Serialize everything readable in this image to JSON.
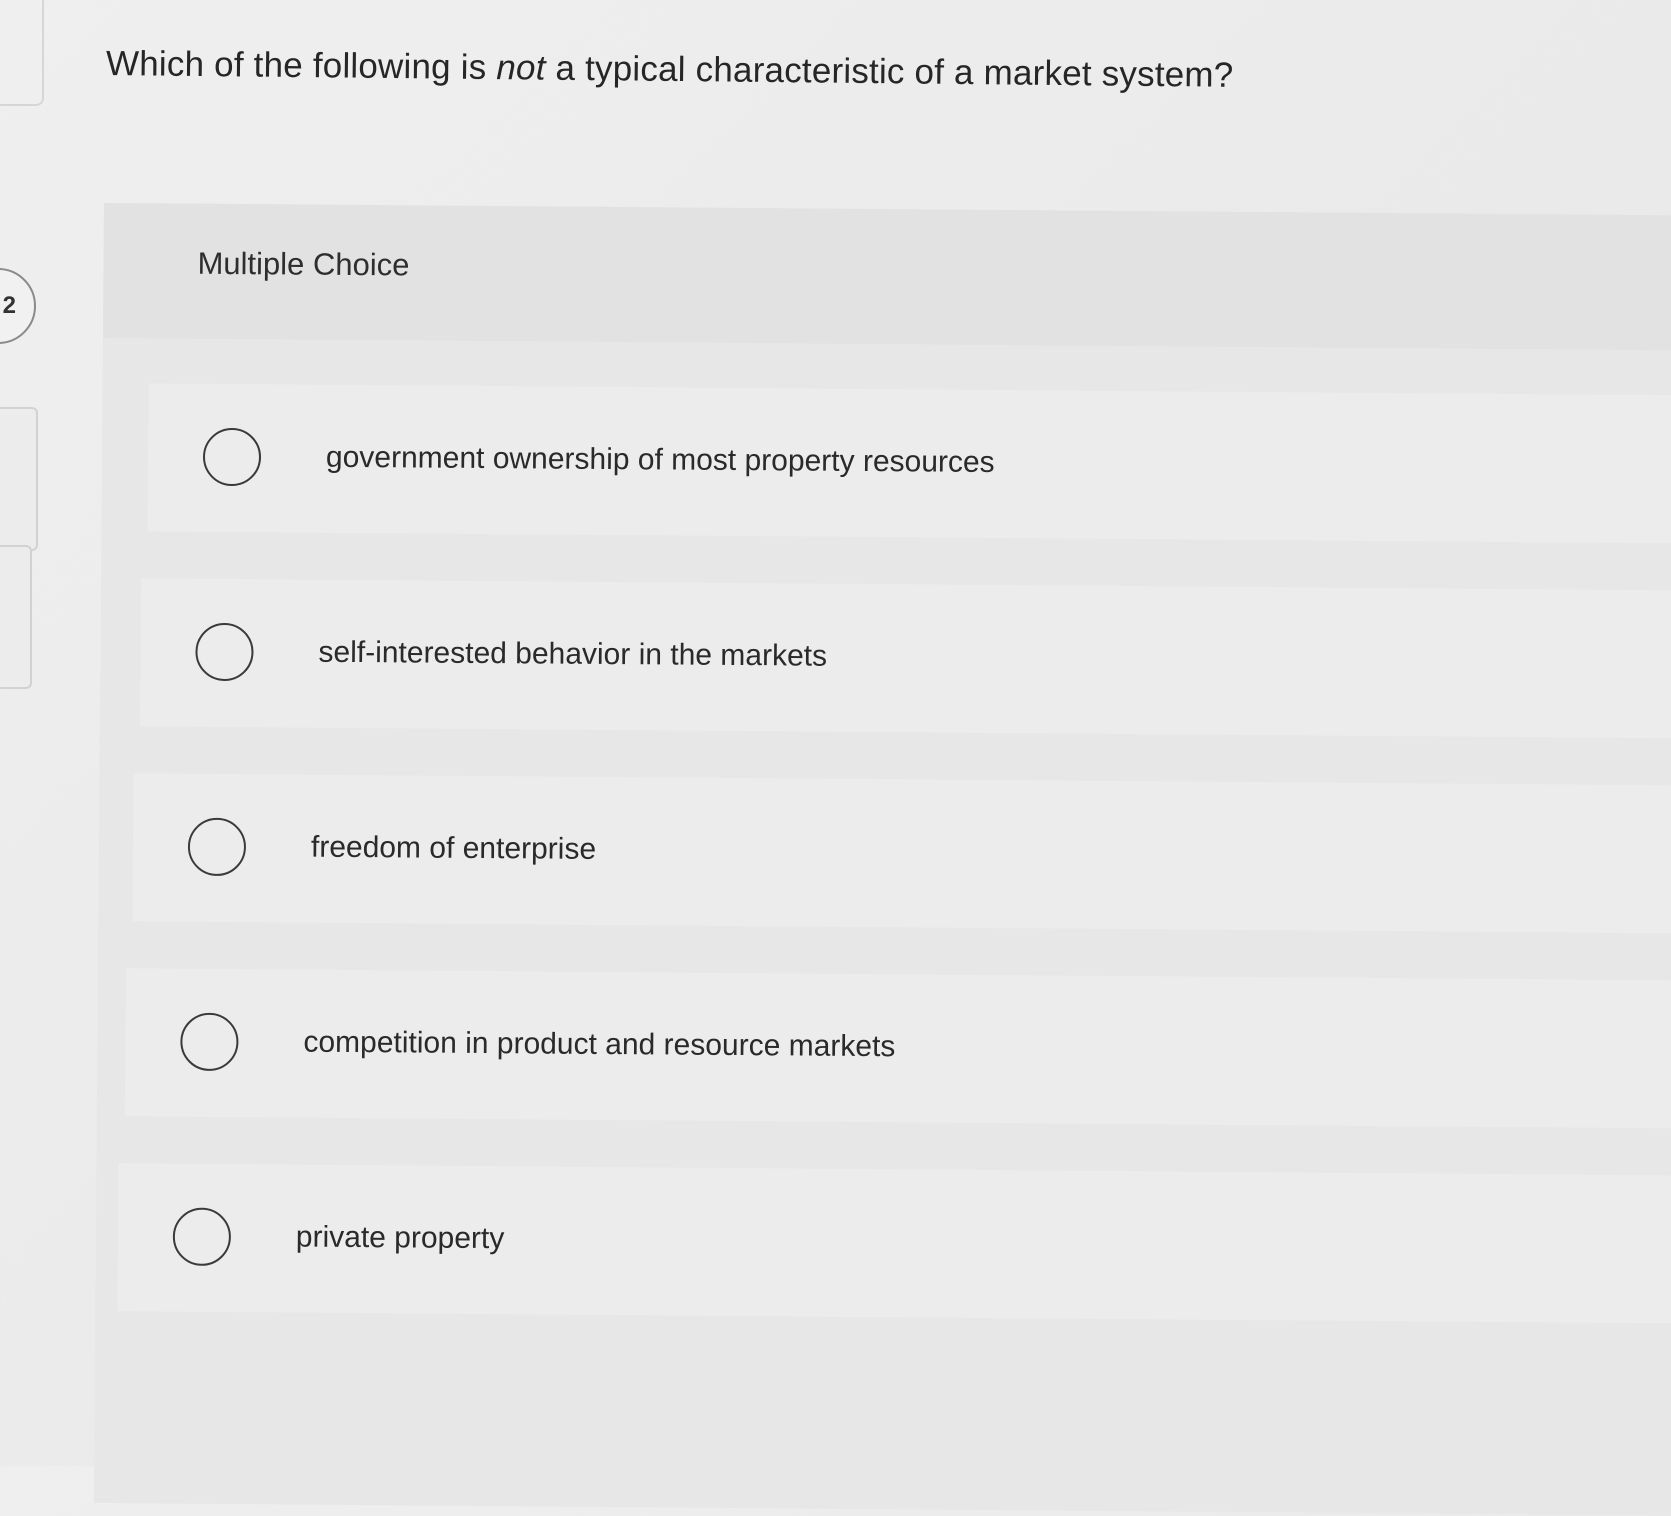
{
  "question": {
    "number_fragment": "2",
    "prefix": "Which of the following is ",
    "emphasis": "not",
    "suffix": " a typical characteristic of a market system?"
  },
  "mc": {
    "label": "Multiple Choice",
    "options": [
      {
        "text": "government ownership of most property resources"
      },
      {
        "text": "self-interested behavior in the markets"
      },
      {
        "text": "freedom of enterprise"
      },
      {
        "text": "competition in product and resource markets"
      },
      {
        "text": "private property"
      }
    ]
  }
}
